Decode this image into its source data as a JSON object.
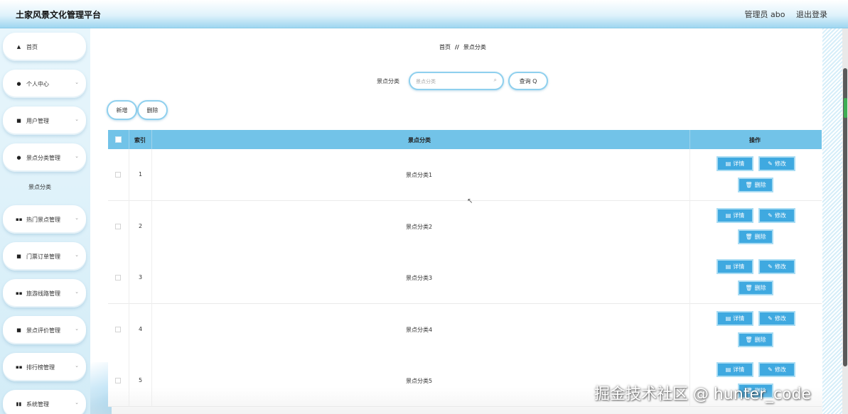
{
  "app": {
    "title": "土家风景文化管理平台"
  },
  "user": {
    "name": "管理员 abo",
    "logout": "退出登录"
  },
  "sidebar": {
    "items": [
      {
        "label": "首页",
        "icon": "home-icon",
        "glyph": "▲",
        "chevron": false
      },
      {
        "label": "个人中心",
        "icon": "person-icon",
        "glyph": "●",
        "chevron": true
      },
      {
        "label": "用户管理",
        "icon": "card-icon",
        "glyph": "■",
        "chevron": true
      },
      {
        "label": "景点分类管理",
        "icon": "person-icon",
        "glyph": "●",
        "chevron": true
      },
      {
        "label": "热门景点管理",
        "icon": "grid-icon",
        "glyph": "▪▪",
        "chevron": true
      },
      {
        "label": "门票订单管理",
        "icon": "ticket-icon",
        "glyph": "■",
        "chevron": true
      },
      {
        "label": "旅游线路管理",
        "icon": "grid-icon",
        "glyph": "▪▪",
        "chevron": true
      },
      {
        "label": "景点评价管理",
        "icon": "video-icon",
        "glyph": "■",
        "chevron": true
      },
      {
        "label": "排行榜管理",
        "icon": "grid-icon",
        "glyph": "▪▪",
        "chevron": true
      },
      {
        "label": "系统管理",
        "icon": "chart-icon",
        "glyph": "▮▮",
        "chevron": true
      }
    ],
    "sub_item": "景点分类",
    "chevron_glyph": "⌄"
  },
  "breadcrumb": {
    "home": "首页",
    "separator": "//",
    "current": "景点分类"
  },
  "search": {
    "label": "景点分类",
    "placeholder": "景点分类",
    "value": "",
    "query_button": "查询 Q"
  },
  "toolbar": {
    "add": "新增",
    "delete": "删除"
  },
  "table": {
    "headers": {
      "index": "索引",
      "category": "景点分类",
      "actions": "操作"
    },
    "rows": [
      {
        "index": "1",
        "category": "景点分类1"
      },
      {
        "index": "2",
        "category": "景点分类2"
      },
      {
        "index": "3",
        "category": "景点分类3"
      },
      {
        "index": "4",
        "category": "景点分类4"
      },
      {
        "index": "5",
        "category": "景点分类5"
      }
    ],
    "actions": {
      "detail": "详情",
      "edit": "修改",
      "delete": "删除"
    }
  },
  "watermark": "掘金技术社区 @ hunter_code",
  "colors": {
    "header_row": "#72c3e8",
    "action_button": "#3fa9e0",
    "accent_border": "#8fd0ee"
  }
}
